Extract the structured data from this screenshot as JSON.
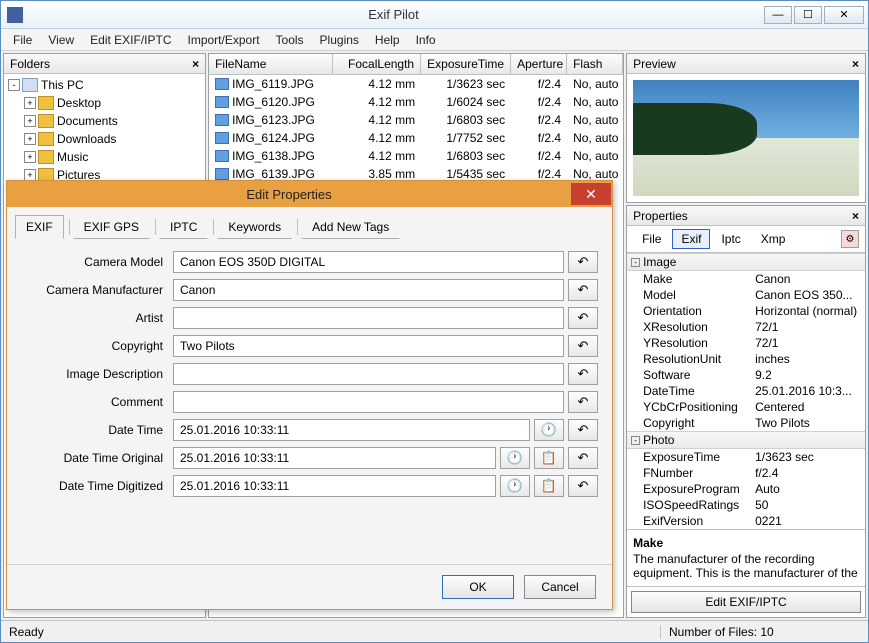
{
  "app": {
    "title": "Exif Pilot"
  },
  "menu": [
    "File",
    "View",
    "Edit EXIF/IPTC",
    "Import/Export",
    "Tools",
    "Plugins",
    "Help",
    "Info"
  ],
  "folders": {
    "header": "Folders",
    "nodes": [
      {
        "label": "This PC",
        "exp": "-",
        "type": "pc",
        "lv": 0
      },
      {
        "label": "Desktop",
        "exp": "+",
        "type": "folder",
        "lv": 1
      },
      {
        "label": "Documents",
        "exp": "+",
        "type": "folder",
        "lv": 1
      },
      {
        "label": "Downloads",
        "exp": "+",
        "type": "folder",
        "lv": 1
      },
      {
        "label": "Music",
        "exp": "+",
        "type": "folder",
        "lv": 1
      },
      {
        "label": "Pictures",
        "exp": "+",
        "type": "folder",
        "lv": 1
      }
    ]
  },
  "grid": {
    "headers": [
      "FileName",
      "FocalLength",
      "ExposureTime",
      "Aperture",
      "Flash"
    ],
    "rows": [
      {
        "name": "IMG_6119.JPG",
        "fl": "4.12 mm",
        "et": "1/3623 sec",
        "ap": "f/2.4",
        "flash": "No, auto"
      },
      {
        "name": "IMG_6120.JPG",
        "fl": "4.12 mm",
        "et": "1/6024 sec",
        "ap": "f/2.4",
        "flash": "No, auto"
      },
      {
        "name": "IMG_6123.JPG",
        "fl": "4.12 mm",
        "et": "1/6803 sec",
        "ap": "f/2.4",
        "flash": "No, auto"
      },
      {
        "name": "IMG_6124.JPG",
        "fl": "4.12 mm",
        "et": "1/7752 sec",
        "ap": "f/2.4",
        "flash": "No, auto"
      },
      {
        "name": "IMG_6138.JPG",
        "fl": "4.12 mm",
        "et": "1/6803 sec",
        "ap": "f/2.4",
        "flash": "No, auto"
      },
      {
        "name": "IMG_6139.JPG",
        "fl": "3.85 mm",
        "et": "1/5435 sec",
        "ap": "f/2.4",
        "flash": "No, auto"
      }
    ]
  },
  "preview": {
    "header": "Preview"
  },
  "props": {
    "header": "Properties",
    "tabs": [
      "File",
      "Exif",
      "Iptc",
      "Xmp"
    ],
    "active_tab": "Exif",
    "sections": [
      {
        "title": "Image",
        "items": [
          {
            "k": "Make",
            "v": "Canon"
          },
          {
            "k": "Model",
            "v": "Canon EOS 350..."
          },
          {
            "k": "Orientation",
            "v": "Horizontal (normal)"
          },
          {
            "k": "XResolution",
            "v": "72/1"
          },
          {
            "k": "YResolution",
            "v": "72/1"
          },
          {
            "k": "ResolutionUnit",
            "v": "inches"
          },
          {
            "k": "Software",
            "v": "9.2"
          },
          {
            "k": "DateTime",
            "v": "25.01.2016 10:3..."
          },
          {
            "k": "YCbCrPositioning",
            "v": "Centered"
          },
          {
            "k": "Copyright",
            "v": "Two Pilots"
          }
        ]
      },
      {
        "title": "Photo",
        "items": [
          {
            "k": "ExposureTime",
            "v": "1/3623 sec"
          },
          {
            "k": "FNumber",
            "v": "f/2.4"
          },
          {
            "k": "ExposureProgram",
            "v": "Auto"
          },
          {
            "k": "ISOSpeedRatings",
            "v": "50"
          },
          {
            "k": "ExifVersion",
            "v": "0221"
          }
        ]
      }
    ],
    "desc_title": "Make",
    "desc_text": "The manufacturer of the recording equipment. This is the manufacturer of the",
    "edit_button": "Edit EXIF/IPTC"
  },
  "status": {
    "left": "Ready",
    "right": "Number of Files: 10"
  },
  "dialog": {
    "title": "Edit Properties",
    "tabs": [
      "EXIF",
      "EXIF GPS",
      "IPTC",
      "Keywords",
      "Add New Tags"
    ],
    "active_tab": "EXIF",
    "fields": [
      {
        "label": "Camera Model",
        "value": "Canon EOS 350D DIGITAL",
        "btns": [
          "undo"
        ]
      },
      {
        "label": "Camera Manufacturer",
        "value": "Canon",
        "btns": [
          "undo"
        ]
      },
      {
        "label": "Artist",
        "value": "",
        "btns": [
          "undo"
        ]
      },
      {
        "label": "Copyright",
        "value": "Two Pilots",
        "btns": [
          "undo"
        ]
      },
      {
        "label": "Image Description",
        "value": "",
        "btns": [
          "undo"
        ]
      },
      {
        "label": "Comment",
        "value": "",
        "btns": [
          "undo"
        ]
      },
      {
        "label": "Date Time",
        "value": "25.01.2016 10:33:11",
        "btns": [
          "clock",
          "undo"
        ]
      },
      {
        "label": "Date Time Original",
        "value": "25.01.2016 10:33:11",
        "btns": [
          "clock",
          "copy",
          "undo"
        ]
      },
      {
        "label": "Date Time Digitized",
        "value": "25.01.2016 10:33:11",
        "btns": [
          "clock",
          "copy",
          "undo"
        ]
      }
    ],
    "ok": "OK",
    "cancel": "Cancel"
  }
}
